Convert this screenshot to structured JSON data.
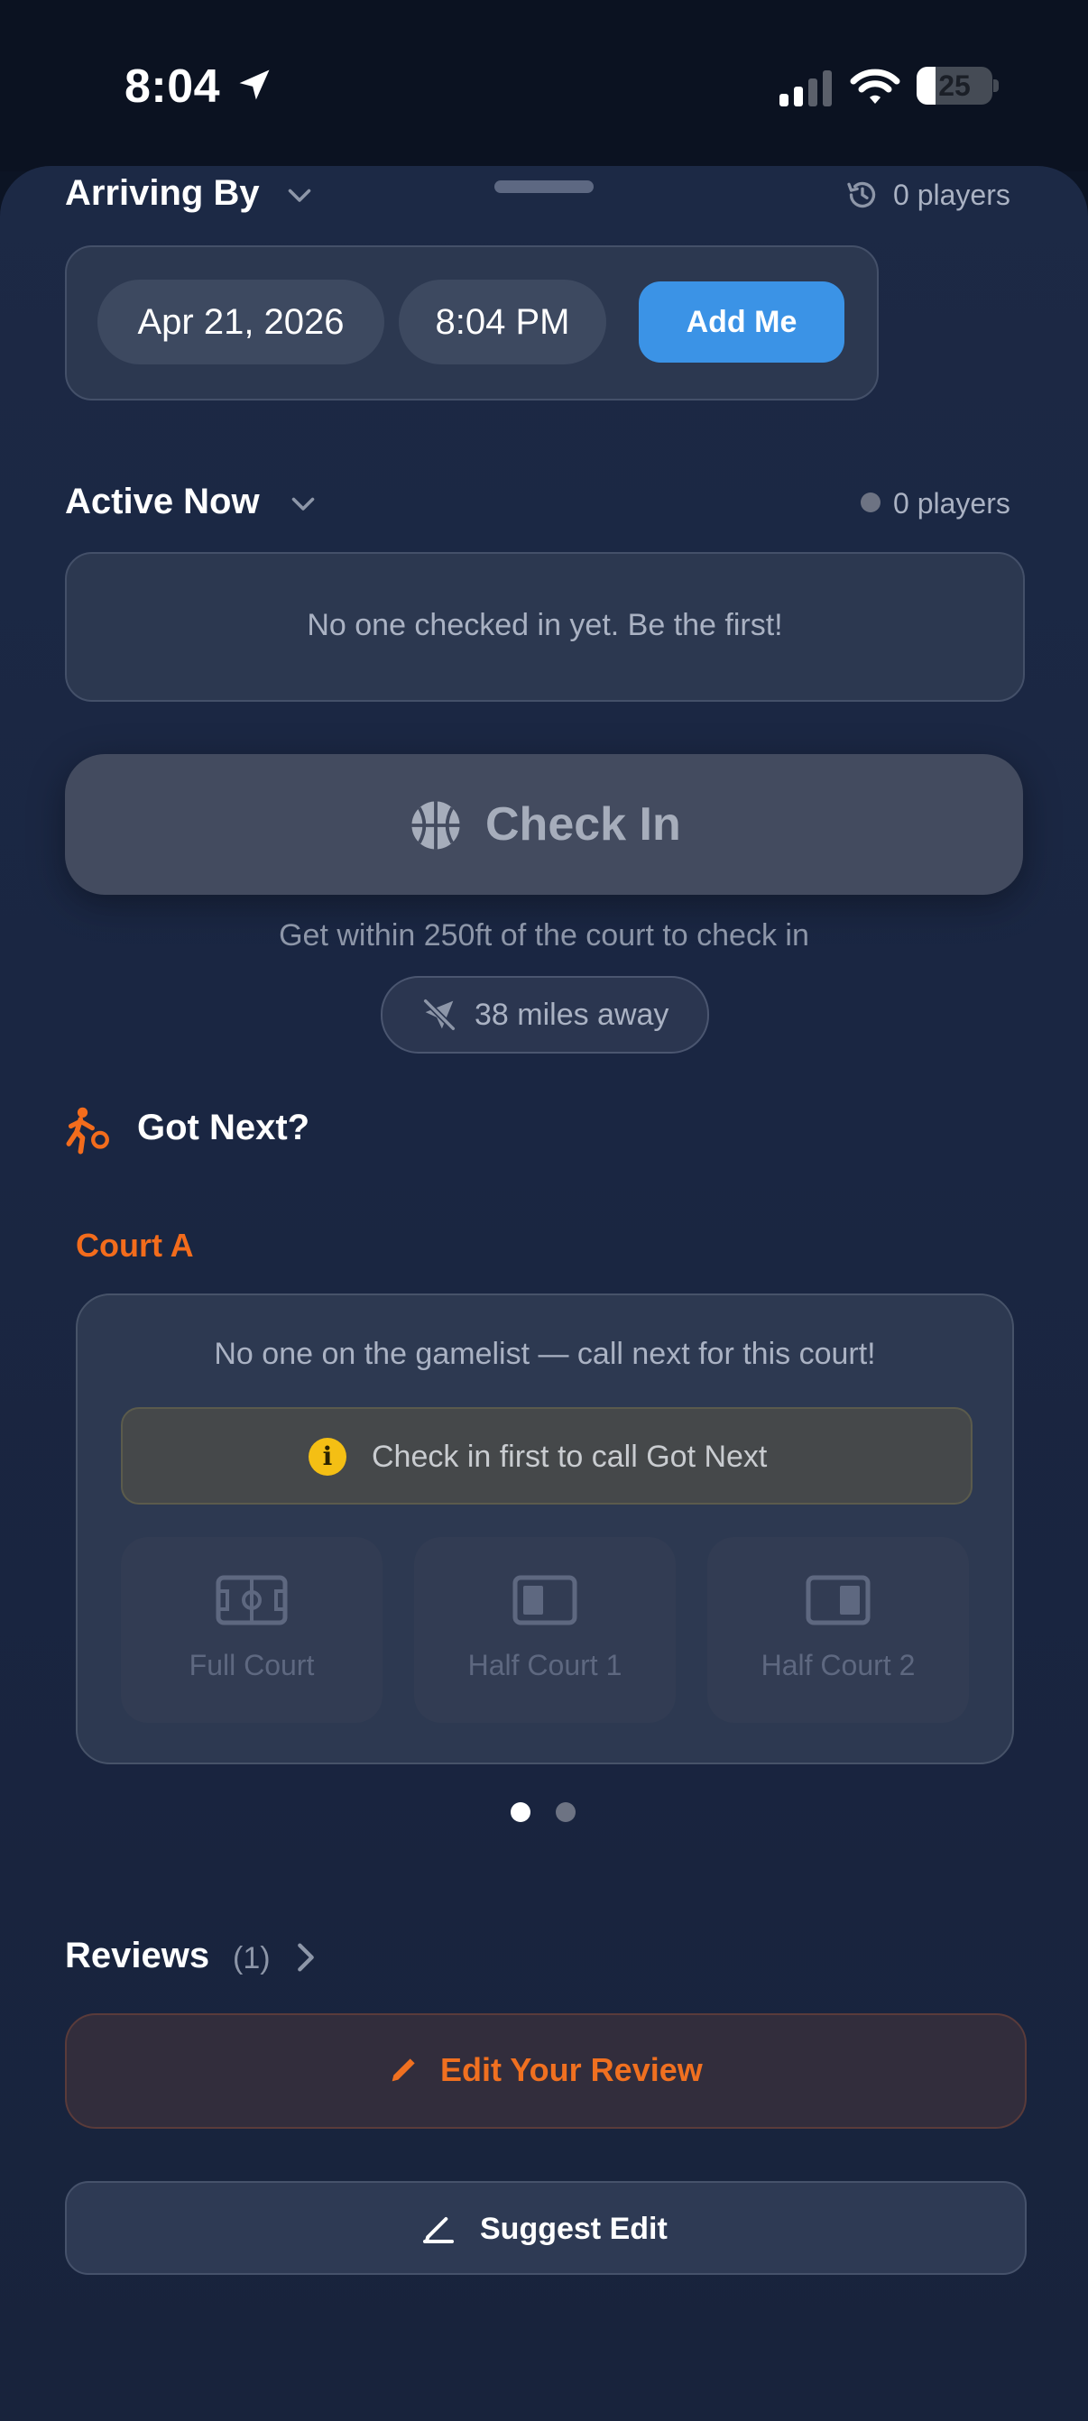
{
  "status_bar": {
    "time": "8:04",
    "battery_level": "25",
    "battery_fraction": 0.25
  },
  "arriving_by": {
    "title": "Arriving By",
    "count_text": "0 players",
    "date": "Apr 21, 2026",
    "time": "8:04 PM",
    "add_button": "Add Me"
  },
  "active_now": {
    "title": "Active Now",
    "count_text": "0 players",
    "empty_text": "No one checked in yet. Be the first!"
  },
  "check_in": {
    "button_label": "Check In",
    "hint": "Get within 250ft of the court to check in",
    "distance": "38 miles away"
  },
  "got_next": {
    "title": "Got Next?",
    "court_name": "Court A",
    "empty_text": "No one on the gamelist — call next for this court!",
    "warning": "Check in first to call Got Next",
    "options": [
      "Full Court",
      "Half Court 1",
      "Half Court 2"
    ],
    "page_count": 2,
    "active_page": 1
  },
  "reviews": {
    "title": "Reviews",
    "count": "(1)",
    "edit_button": "Edit Your Review"
  },
  "suggest_edit": {
    "label": "Suggest Edit"
  },
  "colors": {
    "accent_orange": "#f36c1c",
    "accent_blue": "#3b93e6",
    "warning_yellow": "#f4bf14",
    "background": "#1b2742"
  }
}
